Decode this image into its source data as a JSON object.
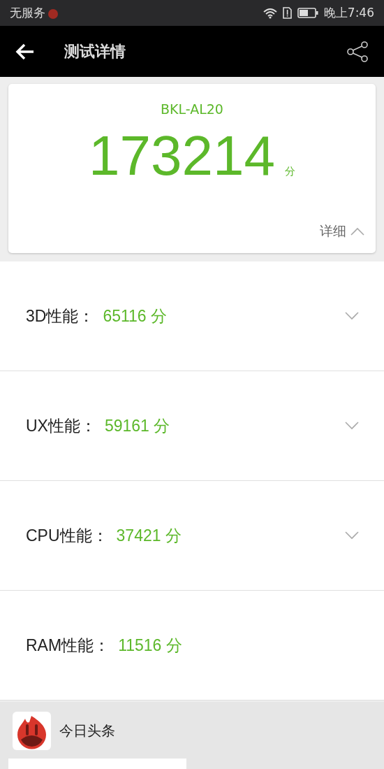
{
  "status_bar": {
    "carrier": "无服务",
    "time": "晚上7:46"
  },
  "toolbar": {
    "title": "测试详情"
  },
  "summary": {
    "device": "BKL-AL20",
    "score": "173214",
    "unit": "分",
    "detail_toggle": {
      "label": "详细",
      "expanded": true
    }
  },
  "categories": [
    {
      "label": "3D性能：",
      "score": "65116 分",
      "expandable": true
    },
    {
      "label": "UX性能：",
      "score": "59161 分",
      "expandable": true
    },
    {
      "label": "CPU性能：",
      "score": "37421 分",
      "expandable": true
    },
    {
      "label": "RAM性能：",
      "score": "11516 分",
      "expandable": false
    }
  ],
  "share_panel": {
    "app_label": "今日头条"
  }
}
